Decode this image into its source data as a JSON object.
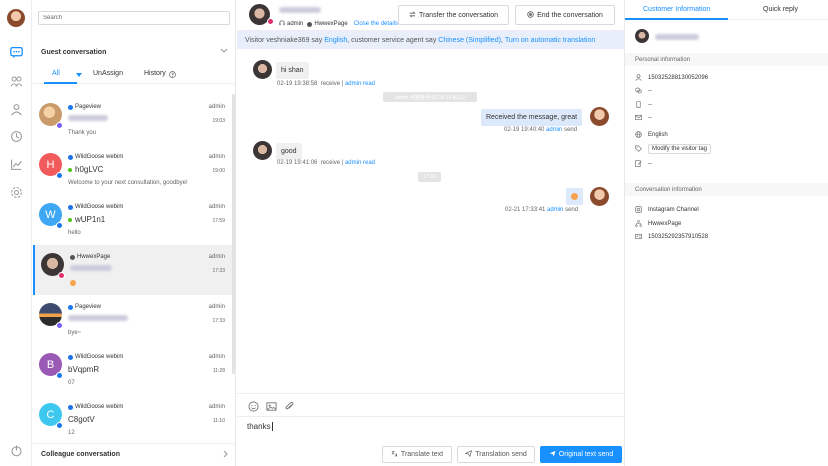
{
  "search": {
    "placeholder": "Search"
  },
  "list": {
    "guest_title": "Guest conversation",
    "tabs": [
      "All",
      "UnAssign",
      "History"
    ],
    "colleague_title": "Colleague conversation",
    "items": [
      {
        "source": "Pageview",
        "assignee": "admin",
        "time": "19:03",
        "name": "",
        "preview": "Thank you",
        "avatar_letter": "",
        "avatar_color": "#c99b6b",
        "badge_color": "#1877f2",
        "source_color": "#1877f2"
      },
      {
        "source": "WildGoose webim",
        "assignee": "admin",
        "time": "19:00",
        "name": "h0gLVC",
        "preview": "Welcome to your next consultation, goodbye!",
        "avatar_letter": "H",
        "avatar_color": "#f25b5b",
        "badge_color": "#1877f2",
        "source_color": "#1a73e8"
      },
      {
        "source": "WildGoose webim",
        "assignee": "admin",
        "time": "17:59",
        "name": "wUP1n1",
        "preview": "hello",
        "avatar_letter": "W",
        "avatar_color": "#3ea8f5",
        "badge_color": "#1877f2",
        "source_color": "#1a73e8"
      },
      {
        "source": "HwwexPage",
        "assignee": "admin",
        "time": "17:33",
        "name": "",
        "preview": "",
        "avatar_letter": "",
        "avatar_color": "#3b3535",
        "badge_color": "#e1306c",
        "source_color": "#555"
      },
      {
        "source": "Pageview",
        "assignee": "admin",
        "time": "17:33",
        "name": "",
        "preview": "bye~",
        "avatar_letter": "",
        "avatar_color": "#e08a3c",
        "badge_color": "#7b5cff",
        "source_color": "#1877f2"
      },
      {
        "source": "WildGoose webim",
        "assignee": "admin",
        "time": "11:28",
        "name": "bVqpmR",
        "preview": "07",
        "avatar_letter": "B",
        "avatar_color": "#9b59b6",
        "badge_color": "#1877f2",
        "source_color": "#1a73e8"
      },
      {
        "source": "WildGoose webim",
        "assignee": "admin",
        "time": "11:10",
        "name": "C8gotV",
        "preview": "12",
        "avatar_letter": "C",
        "avatar_color": "#3ec8f0",
        "badge_color": "#1877f2",
        "source_color": "#1a73e8"
      }
    ]
  },
  "chat": {
    "header": {
      "agent": "admin",
      "page": "HwwexPage",
      "close_details": "Close the details"
    },
    "buttons": {
      "transfer": "Transfer the conversation",
      "end": "End the conversation"
    },
    "translation_bar": {
      "prefix": "Visitor veshniake369 say",
      "visitor_lang": "English",
      "middle": ", customer service agent say",
      "agent_lang": "Chinese (Simplified)",
      "sep": ",",
      "auto": "Turn on automatic translation"
    },
    "messages": [
      {
        "text": "hi shan",
        "meta": "02-19 19:38:58",
        "status": "receive |",
        "link": "admin",
        "tail": "read"
      },
      {
        "text": "Received the message, great",
        "meta": "02-19 19:40:40",
        "link": "admin",
        "tail": "send"
      },
      {
        "text": "good",
        "meta": "02-19 19:41:06",
        "status": "receive |",
        "link": "admin",
        "tail": "read"
      },
      {
        "text": "",
        "meta": "02-21 17:33:41",
        "link": "admin",
        "tail": "send"
      }
    ],
    "system_notices": [
      "admin 可能接待 02-19 19:40:12",
      "17:33"
    ],
    "composer_text": "thanks",
    "footer": {
      "translate": "Translate text",
      "translation_send": "Translation send",
      "original_send": "Original text send"
    }
  },
  "right": {
    "tabs": [
      "Customer Information",
      "Quick reply"
    ],
    "personal_title": "Personal information",
    "personal": {
      "id": "1503252881​30052096",
      "wechat": "--",
      "phone": "--",
      "email": "--",
      "language": "English",
      "tag": "Modify the visitor tag",
      "note": "--"
    },
    "conversation_title": "Conversation information",
    "conversation": {
      "channel": "Instagram Channel",
      "page": "HwwexPage",
      "id": "150325292357910528"
    }
  },
  "colors": {
    "accent": "#1890ff",
    "instagram": "#e1306c",
    "messenger": "#1877f2"
  }
}
